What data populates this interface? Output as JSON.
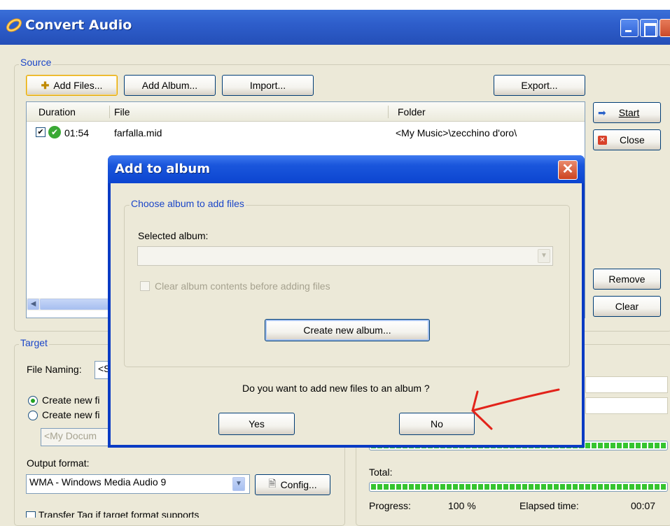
{
  "window": {
    "title": "Convert Audio"
  },
  "source": {
    "label": "Source",
    "buttons": {
      "add_files": "Add Files...",
      "add_album": "Add Album...",
      "import": "Import...",
      "export": "Export..."
    },
    "columns": {
      "duration": "Duration",
      "file": "File",
      "folder": "Folder"
    },
    "rows": [
      {
        "checked": true,
        "duration": "01:54",
        "file": "farfalla.mid",
        "folder": "<My Music>\\zecchino d'oro\\"
      }
    ]
  },
  "side_buttons": {
    "start": "Start",
    "close": "Close",
    "remove": "Remove",
    "clear": "Clear"
  },
  "target": {
    "label": "Target",
    "file_naming_label": "File Naming:",
    "file_naming_value": "<S",
    "radio1_label": "Create new fi",
    "radio2_label": "Create new fi",
    "folder_value": "<My Docum",
    "output_format_label": "Output format:",
    "output_format_value": "WMA - Windows Media Audio 9",
    "config_label": "Config...",
    "transfer_label": "Transfer Tag if target format supports"
  },
  "status": {
    "total_label": "Total:",
    "progress_label": "Progress:",
    "progress_value": "100 %",
    "elapsed_label": "Elapsed time:",
    "elapsed_value": "00:07",
    "file_progress_fraction": 1.0,
    "total_progress_fraction": 1.0
  },
  "dialog": {
    "title": "Add to album",
    "group_label": "Choose album to add files",
    "selected_album_label": "Selected album:",
    "selected_album_value": "",
    "clear_contents_label": "Clear album contents before adding files",
    "create_new_album": "Create new album...",
    "question": "Do you want to add new files to an album ?",
    "yes": "Yes",
    "no": "No"
  },
  "colors": {
    "titlebar": "#2e5ecb",
    "dialog_border": "#0a3bc4",
    "annotation_arrow": "#e2231a",
    "group_label": "#1b46c8"
  }
}
